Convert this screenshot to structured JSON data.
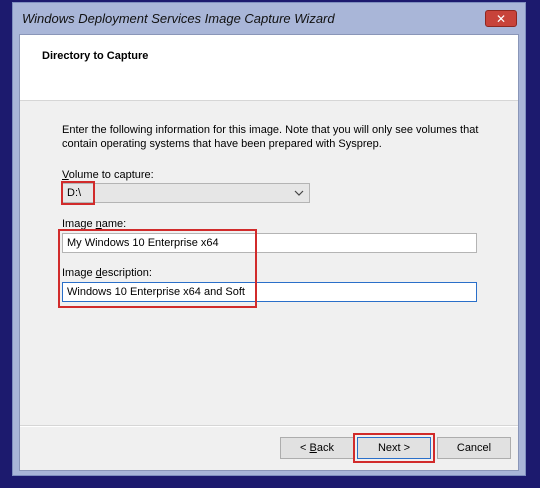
{
  "window": {
    "title": "Windows Deployment Services Image Capture Wizard",
    "close_glyph": "✕"
  },
  "header": {
    "title": "Directory to Capture"
  },
  "intro": "Enter the following information for this image. Note that you will only see volumes that contain operating systems that have been prepared with Sysprep.",
  "volume": {
    "label_pre": "",
    "label_accel": "V",
    "label_post": "olume to capture:",
    "value": "D:\\"
  },
  "image_name": {
    "label_pre": "Image ",
    "label_accel": "n",
    "label_post": "ame:",
    "value": "My Windows 10 Enterprise x64"
  },
  "image_description": {
    "label_pre": "Image ",
    "label_accel": "d",
    "label_post": "escription:",
    "value": "Windows 10 Enterprise x64 and Soft"
  },
  "buttons": {
    "back": {
      "pre": "< ",
      "accel": "B",
      "post": "ack"
    },
    "next": "Next >",
    "cancel": "Cancel"
  },
  "colors": {
    "highlight": "#d12b2b",
    "focus_border": "#2a6fc9",
    "close_button": "#c8433a"
  },
  "icons": {
    "close": "close-icon",
    "dropdown": "chevron-down-icon"
  }
}
